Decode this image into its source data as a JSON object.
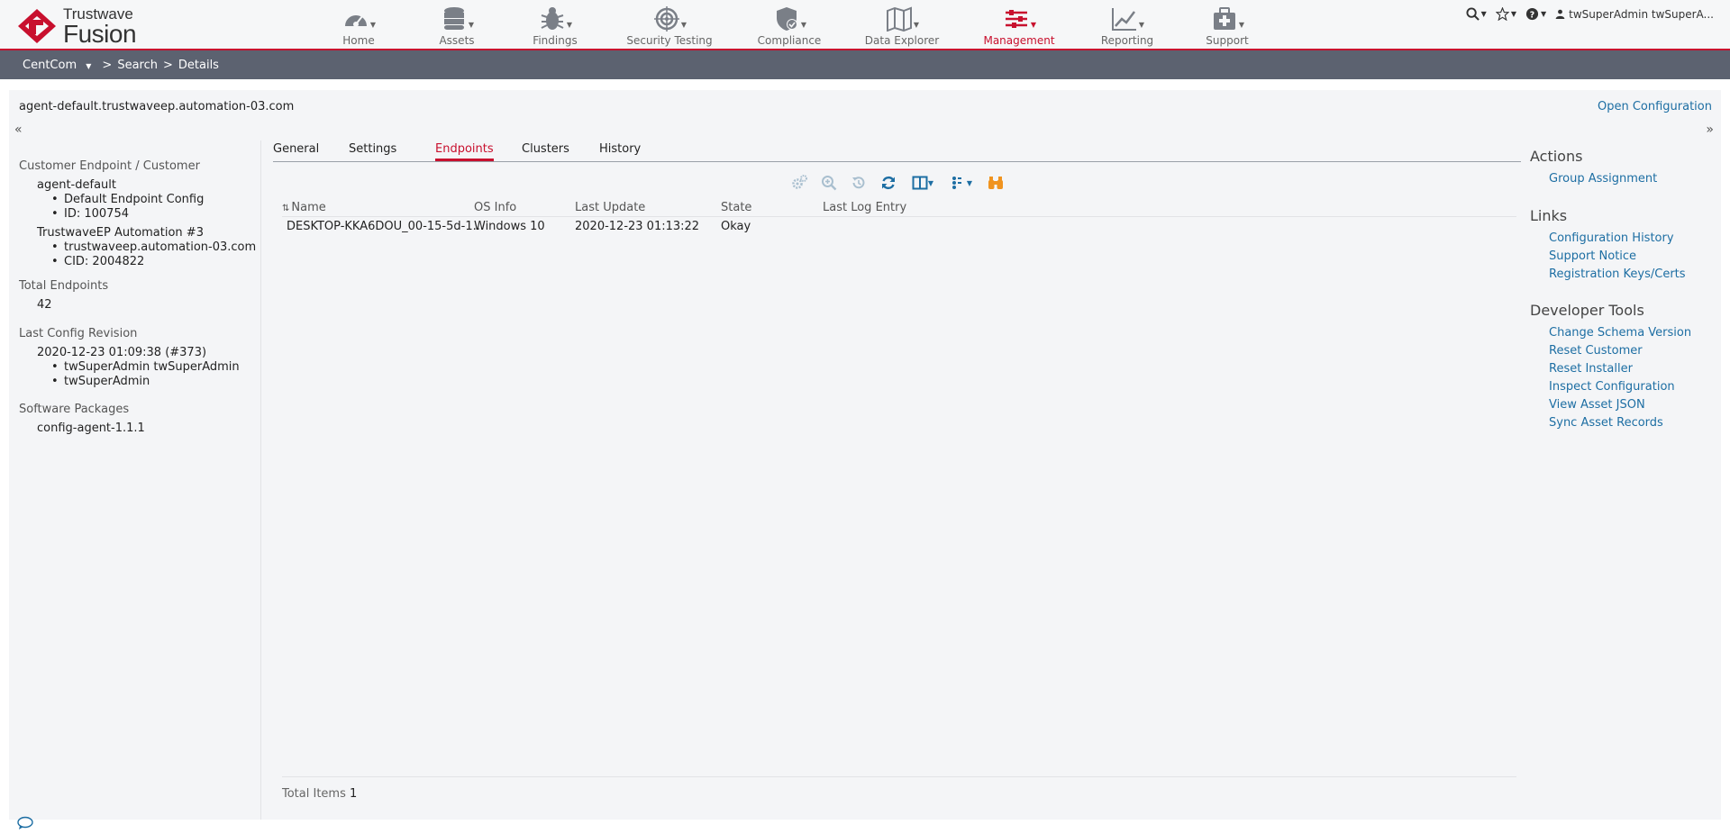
{
  "brand": {
    "name": "Trustwave",
    "product": "Fusion",
    "accent": "#c8102e",
    "link_color": "#1d6ea3"
  },
  "nav": [
    {
      "label": "Home",
      "icon": "dashboard-gauge-icon"
    },
    {
      "label": "Assets",
      "icon": "database-icon"
    },
    {
      "label": "Findings",
      "icon": "bug-icon"
    },
    {
      "label": "Security Testing",
      "icon": "target-icon"
    },
    {
      "label": "Compliance",
      "icon": "shield-check-icon"
    },
    {
      "label": "Data Explorer",
      "icon": "map-icon"
    },
    {
      "label": "Management",
      "icon": "sliders-icon",
      "active": true
    },
    {
      "label": "Reporting",
      "icon": "line-chart-icon"
    },
    {
      "label": "Support",
      "icon": "medkit-icon"
    }
  ],
  "user": {
    "name": "twSuperAdmin twSuperA..."
  },
  "breadcrumb": {
    "root": "CentCom",
    "sep1": ">",
    "search": "Search",
    "sep2": ">",
    "details": "Details"
  },
  "asset": {
    "title": "agent-default.trustwaveep.automation-03.com",
    "open_config": "Open Configuration"
  },
  "left": {
    "customer_label": "Customer Endpoint / Customer",
    "customer_name": "agent-default",
    "customer_config": "Default Endpoint Config",
    "customer_id": "ID: 100754",
    "org_name": "TrustwaveEP Automation #3",
    "org_domain": "trustwaveep.automation-03.com",
    "org_cid": "CID: 2004822",
    "total_endpoints_label": "Total Endpoints",
    "total_endpoints": "42",
    "last_config_label": "Last Config Revision",
    "last_config_value": "2020-12-23 01:09:38 (#373)",
    "last_config_user1": "twSuperAdmin twSuperAdmin",
    "last_config_user2": "twSuperAdmin",
    "software_label": "Software Packages",
    "software_value": "config-agent-1.1.1"
  },
  "tabs": [
    "General",
    "Settings",
    "Endpoints",
    "Clusters",
    "History"
  ],
  "active_tab": "Endpoints",
  "table": {
    "columns": [
      "Name",
      "OS Info",
      "Last Update",
      "State",
      "Last Log Entry"
    ],
    "rows": [
      {
        "name": "DESKTOP-KKA6DOU_00-15-5d-1...",
        "os": "Windows 10",
        "last_update": "2020-12-23 01:13:22",
        "state": "Okay",
        "last_log": ""
      }
    ],
    "total_label": "Total Items",
    "total": "1"
  },
  "right": {
    "actions_title": "Actions",
    "actions": [
      "Group Assignment"
    ],
    "links_title": "Links",
    "links": [
      "Configuration History",
      "Support Notice",
      "Registration Keys/Certs"
    ],
    "dev_title": "Developer Tools",
    "dev": [
      "Change Schema Version",
      "Reset Customer",
      "Reset Installer",
      "Inspect Configuration",
      "View Asset JSON",
      "Sync Asset Records"
    ]
  }
}
